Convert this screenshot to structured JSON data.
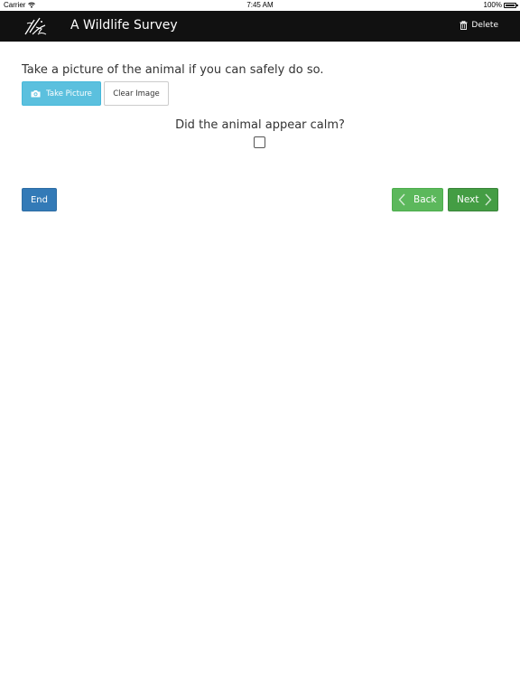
{
  "status_bar": {
    "carrier": "Carrier",
    "time": "7:45 AM",
    "battery": "100%",
    "icons": [
      "wifi-icon",
      "battery-icon"
    ]
  },
  "nav": {
    "title": "A Wildlife Survey",
    "logo_icon": "logo-icon",
    "delete_label": "Delete",
    "delete_icon": "trash-icon",
    "bg_color": "#111111"
  },
  "photo_question": {
    "prompt": "Take a picture of the animal if you can safely do so.",
    "take_picture_label": "Take Picture",
    "take_picture_icon": "camera-icon",
    "clear_image_label": "Clear Image",
    "take_picture_color": "#5bc0de"
  },
  "calm_question": {
    "prompt": "Did the animal appear calm?",
    "checked": false
  },
  "footer_nav": {
    "end_label": "End",
    "back_label": "Back",
    "next_label": "Next",
    "end_color": "#337ab7",
    "back_color": "#5cb85c",
    "next_color": "#449d44"
  }
}
